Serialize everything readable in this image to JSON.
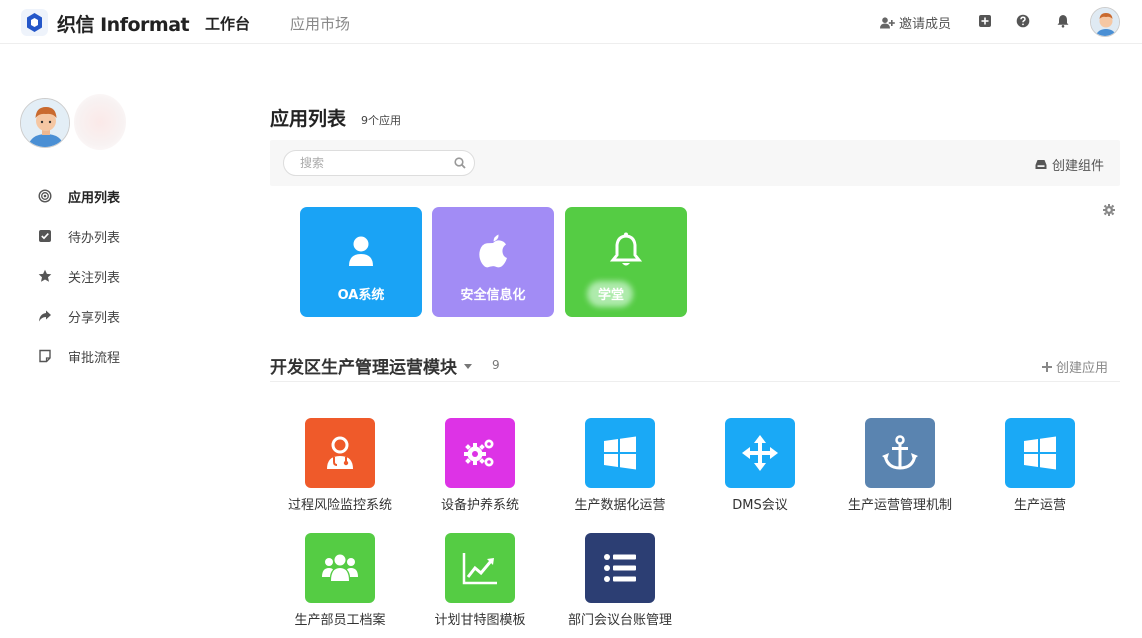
{
  "header": {
    "logo_text": "织信 Informat",
    "tabs": [
      {
        "label": "工作台",
        "active": true
      },
      {
        "label": "应用市场",
        "active": false
      }
    ],
    "invite_label": "邀请成员",
    "icons": [
      "plus-square-icon",
      "help-icon",
      "bell-icon"
    ]
  },
  "sidebar": {
    "items": [
      {
        "label": "应用列表",
        "icon": "target-icon",
        "active": true
      },
      {
        "label": "待办列表",
        "icon": "checkbox-icon",
        "active": false
      },
      {
        "label": "关注列表",
        "icon": "star-icon",
        "active": false
      },
      {
        "label": "分享列表",
        "icon": "share-arrow-icon",
        "active": false
      },
      {
        "label": "审批流程",
        "icon": "note-icon",
        "active": false
      }
    ]
  },
  "main": {
    "title": "应用列表",
    "count_label": "9个应用",
    "search": {
      "placeholder": "搜索"
    },
    "create_component_label": "创建组件",
    "tiles": [
      {
        "label": "OA系统",
        "icon": "user-icon",
        "color": "#1aa3f5"
      },
      {
        "label": "安全信息化",
        "icon": "apple-icon",
        "color": "#a28cf5"
      },
      {
        "label": "学堂",
        "icon": "bell-icon",
        "color": "#55cc44"
      }
    ],
    "section": {
      "title": "开发区生产管理运营模块",
      "count": "9",
      "create_label": "创建应用",
      "apps": [
        {
          "label": "过程风险监控系统",
          "icon": "doctor-icon",
          "color": "#ef5a2a"
        },
        {
          "label": "设备护养系统",
          "icon": "gears-icon",
          "color": "#dd33e6"
        },
        {
          "label": "生产数据化运营",
          "icon": "windows-icon",
          "color": "#1aa9f6"
        },
        {
          "label": "DMS会议",
          "icon": "move-arrows-icon",
          "color": "#1aa9f6"
        },
        {
          "label": "生产运营管理机制",
          "icon": "anchor-icon",
          "color": "#5a84b0"
        },
        {
          "label": "生产运营",
          "icon": "windows-icon",
          "color": "#1aa9f6"
        },
        {
          "label": "生产部员工档案",
          "icon": "users-group-icon",
          "color": "#55cc44"
        },
        {
          "label": "计划甘特图模板",
          "icon": "line-chart-icon",
          "color": "#55cc44"
        },
        {
          "label": "部门会议台账管理",
          "icon": "list-icon",
          "color": "#2c3e73"
        }
      ]
    }
  }
}
